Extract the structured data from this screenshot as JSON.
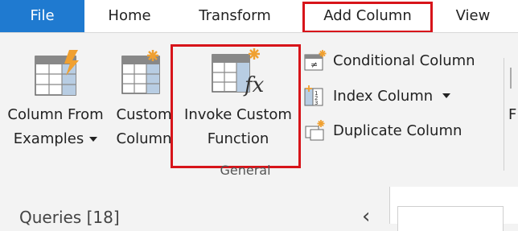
{
  "tabs": {
    "file": "File",
    "home": "Home",
    "transform": "Transform",
    "add_column": "Add Column",
    "view": "View"
  },
  "ribbon": {
    "column_from_examples": {
      "line1": "Column From",
      "line2": "Examples"
    },
    "custom_column": {
      "line1": "Custom",
      "line2": "Column"
    },
    "invoke_custom_function": {
      "line1": "Invoke Custom",
      "line2": "Function"
    },
    "conditional_column": "Conditional Column",
    "index_column": "Index Column",
    "duplicate_column": "Duplicate Column",
    "group_label": "General",
    "cut_off_label": "F"
  },
  "queries_pane": {
    "title": "Queries [18]",
    "collapse_glyph": "‹"
  },
  "colors": {
    "accent": "#1f7ad0",
    "highlight": "#d7141a",
    "column_blue": "#b8cde3",
    "sparkle": "#f0a030"
  }
}
